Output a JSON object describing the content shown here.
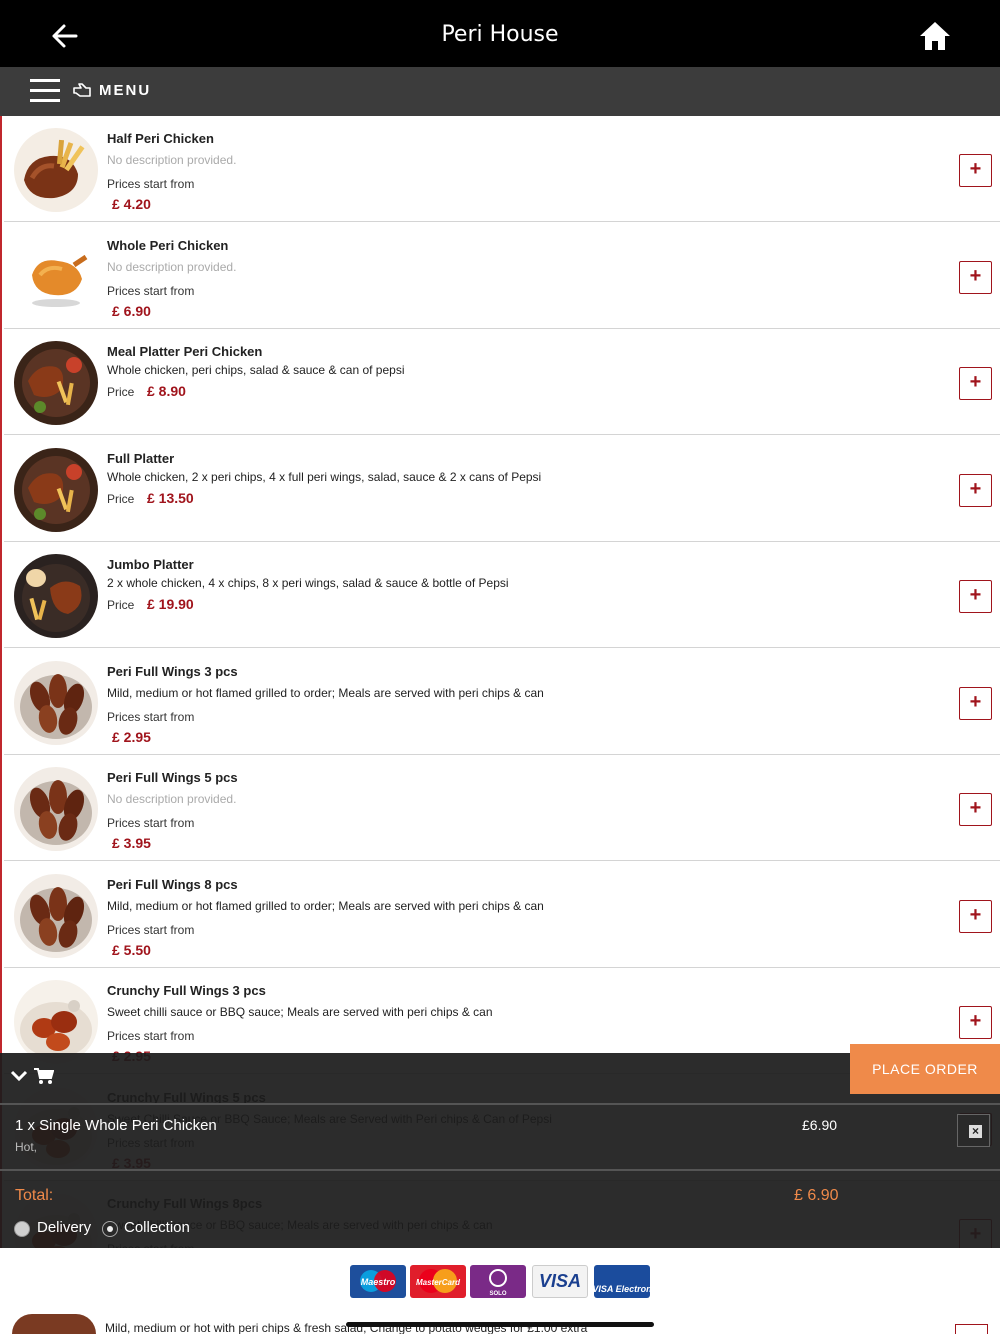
{
  "header": {
    "title": "Peri House",
    "back_icon": "arrow-left-icon",
    "home_icon": "home-icon"
  },
  "menubar": {
    "label": "MENU",
    "hamburger_icon": "hamburger-icon",
    "hand_icon": "hand-pointer-icon"
  },
  "items": [
    {
      "name": "Half Peri Chicken",
      "desc": "No description provided.",
      "desc_empty": true,
      "price_label": "Prices start from",
      "price": "£ 4.20",
      "layout": "stacked",
      "thumb": "half-chicken"
    },
    {
      "name": "Whole Peri Chicken",
      "desc": "No description provided.",
      "desc_empty": true,
      "price_label": "Prices start from",
      "price": "£ 6.90",
      "layout": "stacked",
      "thumb": "whole-chicken"
    },
    {
      "name": "Meal Platter Peri Chicken",
      "desc": "Whole chicken, peri chips, salad & sauce & can of pepsi",
      "desc_empty": false,
      "price_label": "Price",
      "price": "£ 8.90",
      "layout": "inline",
      "thumb": "platter"
    },
    {
      "name": "Full Platter",
      "desc": "Whole chicken, 2 x peri chips, 4 x full peri wings, salad, sauce & 2 x cans of Pepsi",
      "desc_empty": false,
      "price_label": "Price",
      "price": "£ 13.50",
      "layout": "inline",
      "thumb": "platter"
    },
    {
      "name": "Jumbo Platter",
      "desc": "2 x whole chicken, 4 x chips, 8 x peri wings, salad & sauce & bottle of Pepsi",
      "desc_empty": false,
      "price_label": "Price",
      "price": "£ 19.90",
      "layout": "inline",
      "thumb": "jumbo"
    },
    {
      "name": "Peri Full Wings 3 pcs",
      "desc": "Mild, medium or hot flamed grilled to order; Meals are served with peri chips & can",
      "desc_empty": false,
      "price_label": "Prices start from",
      "price": "£ 2.95",
      "layout": "stacked",
      "thumb": "wings"
    },
    {
      "name": "Peri Full Wings 5 pcs",
      "desc": "No description provided.",
      "desc_empty": true,
      "price_label": "Prices start from",
      "price": "£ 3.95",
      "layout": "stacked",
      "thumb": "wings"
    },
    {
      "name": "Peri Full Wings 8 pcs",
      "desc": "Mild, medium or hot flamed grilled to order; Meals are served with peri chips & can",
      "desc_empty": false,
      "price_label": "Prices start from",
      "price": "£ 5.50",
      "layout": "stacked",
      "thumb": "wings"
    },
    {
      "name": "Crunchy Full Wings 3 pcs",
      "desc": "Sweet chilli sauce or BBQ sauce; Meals are served with peri chips & can",
      "desc_empty": false,
      "price_label": "Prices start from",
      "price": "£ 2.95",
      "layout": "stacked",
      "thumb": "crunchy"
    },
    {
      "name": "Crunchy Full Wings 5 pcs",
      "desc": "Sweet Chilli Sauce or BBQ Sauce; Meals are Served with Peri chips & Can of Pepsi",
      "desc_empty": false,
      "price_label": "Prices start from",
      "price": "£ 3.95",
      "layout": "stacked",
      "thumb": "crunchy"
    },
    {
      "name": "Crunchy Full Wings 8pcs",
      "desc": "Sweet chilli sauce or BBQ sauce; Meals are served with peri chips & can",
      "desc_empty": false,
      "price_label": "Prices start from",
      "price": "",
      "layout": "stacked",
      "thumb": "crunchy"
    }
  ],
  "add_symbol": "+",
  "cart": {
    "place_order": "PLACE ORDER",
    "line": {
      "text": "1 x Single Whole Peri Chicken",
      "options": "Hot,",
      "price": "£6.90",
      "remove": "×"
    },
    "total_label": "Total:",
    "total_value": "£ 6.90",
    "delivery": "Delivery",
    "collection": "Collection",
    "selected": "collection"
  },
  "payment_cards": [
    "Maestro",
    "MasterCard",
    "SOLO",
    "VISA",
    "VISA Electron"
  ],
  "peek_desc": "Mild, medium or hot with peri chips & fresh salad; Change to potato wedges for £1.00 extra",
  "colors": {
    "accent": "#a0141c",
    "order": "#ef8a4a",
    "topbar": "#000000",
    "menubar": "#3c3c3c"
  }
}
